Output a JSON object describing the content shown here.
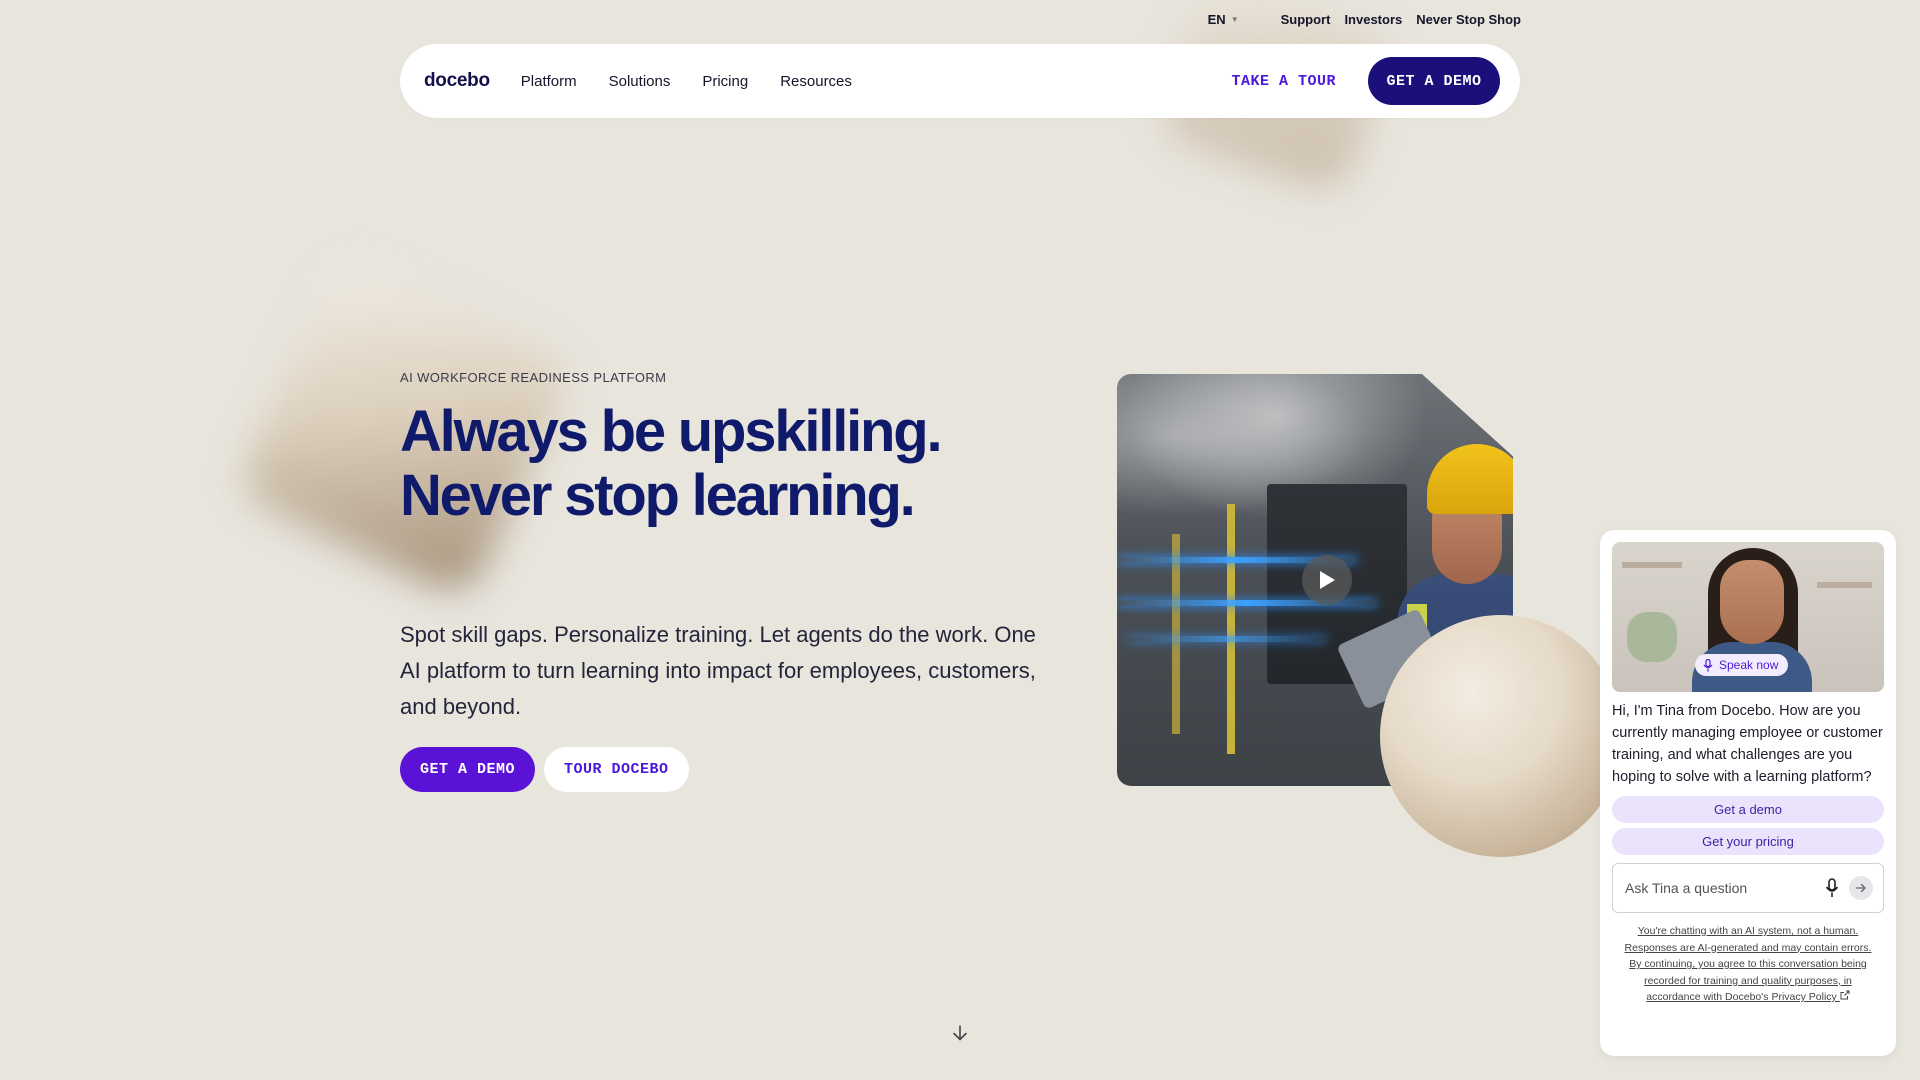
{
  "util_bar": {
    "language": "EN",
    "links": [
      "Support",
      "Investors",
      "Never Stop Shop"
    ]
  },
  "nav": {
    "logo": "docebo",
    "links": [
      "Platform",
      "Solutions",
      "Pricing",
      "Resources"
    ],
    "tour_label": "TAKE A TOUR",
    "demo_label": "GET A DEMO"
  },
  "hero": {
    "eyebrow": "AI WORKFORCE READINESS PLATFORM",
    "headline": "Always be upskilling. Never stop learning.",
    "subcopy": "Spot skill gaps. Personalize training. Let agents do the work. One AI platform to turn learning into impact for employees, customers, and beyond.",
    "primary_cta": "GET A DEMO",
    "secondary_cta": "TOUR DOCEBO"
  },
  "chat": {
    "speak_label": "Speak now",
    "message": "Hi, I'm Tina from Docebo. How are you currently managing employee or customer training, and what challenges are you hoping to solve with a learning platform?",
    "chips": [
      "Get a demo",
      "Get your pricing"
    ],
    "input_placeholder": "Ask Tina a question",
    "disclaimer": "You're chatting with an AI system, not a human. Responses are AI-generated and may contain errors. By continuing, you agree to this conversation being recorded for training and quality purposes, in accordance with Docebo's",
    "privacy_label": "Privacy Policy"
  },
  "icons": {
    "language_caret": "chevron-down-icon",
    "play": "play-icon",
    "scroll_down": "arrow-down-icon",
    "microphone": "microphone-icon",
    "send": "arrow-right-icon",
    "external": "external-link-icon"
  },
  "colors": {
    "background": "#e8e5dd",
    "brand_navy": "#1b0f7a",
    "brand_purple": "#5a12d6",
    "headline": "#101a6b"
  }
}
